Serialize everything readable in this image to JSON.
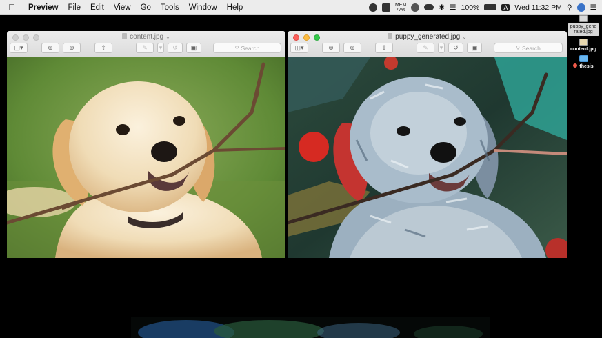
{
  "menubar": {
    "apple": "",
    "app": "Preview",
    "items": [
      "File",
      "Edit",
      "View",
      "Go",
      "Tools",
      "Window",
      "Help"
    ],
    "mem_label": "MEM",
    "mem_value": "77%",
    "battery": "100%",
    "input_source": "A",
    "clock": "Wed 11:32 PM"
  },
  "windows": [
    {
      "title": "content.jpg",
      "search_placeholder": "Search",
      "active": false
    },
    {
      "title": "puppy_generated.jpg",
      "search_placeholder": "Search",
      "active": true
    }
  ],
  "desktop": {
    "files": [
      {
        "label": "puppy_gene rated.jpg",
        "selected": true
      },
      {
        "label": "content.jpg",
        "selected": false
      },
      {
        "label": "thesis",
        "selected": false,
        "tag_color": "#f05a4a"
      }
    ]
  },
  "icons": {
    "sidebar": "sidebar-icon",
    "zoom_out": "zoom-out-icon",
    "zoom_in": "zoom-in-icon",
    "share": "share-icon",
    "markup": "pen-icon",
    "rotate": "rotate-icon",
    "toolbox": "toolbox-icon",
    "search": "search-icon"
  }
}
